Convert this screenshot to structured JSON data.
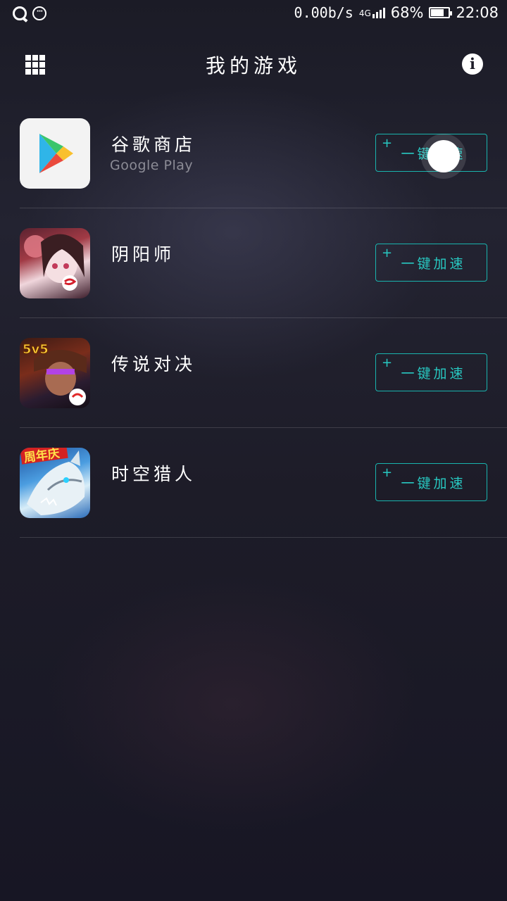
{
  "status_bar": {
    "net_speed": "0.00b/s",
    "network_type": "4G",
    "battery_percent": "68%",
    "time": "22:08"
  },
  "header": {
    "title": "我的游戏",
    "menu_icon": "grid-icon",
    "info_icon": "info-icon"
  },
  "games": [
    {
      "name": "谷歌商店",
      "subtitle": "Google Play",
      "icon": "google-play-icon",
      "button": "一键加速"
    },
    {
      "name": "阴阳师",
      "subtitle": "",
      "icon": "onmyoji-icon",
      "button": "一键加速"
    },
    {
      "name": "传说对决",
      "subtitle": "",
      "icon": "arena-of-valor-icon",
      "button": "一键加速",
      "icon_badge": "5v5"
    },
    {
      "name": "时空猎人",
      "subtitle": "",
      "icon": "time-hunter-icon",
      "button": "一键加速",
      "icon_badge": "周年庆"
    }
  ],
  "colors": {
    "accent": "#28c9c2",
    "background": "#1d1c28"
  }
}
